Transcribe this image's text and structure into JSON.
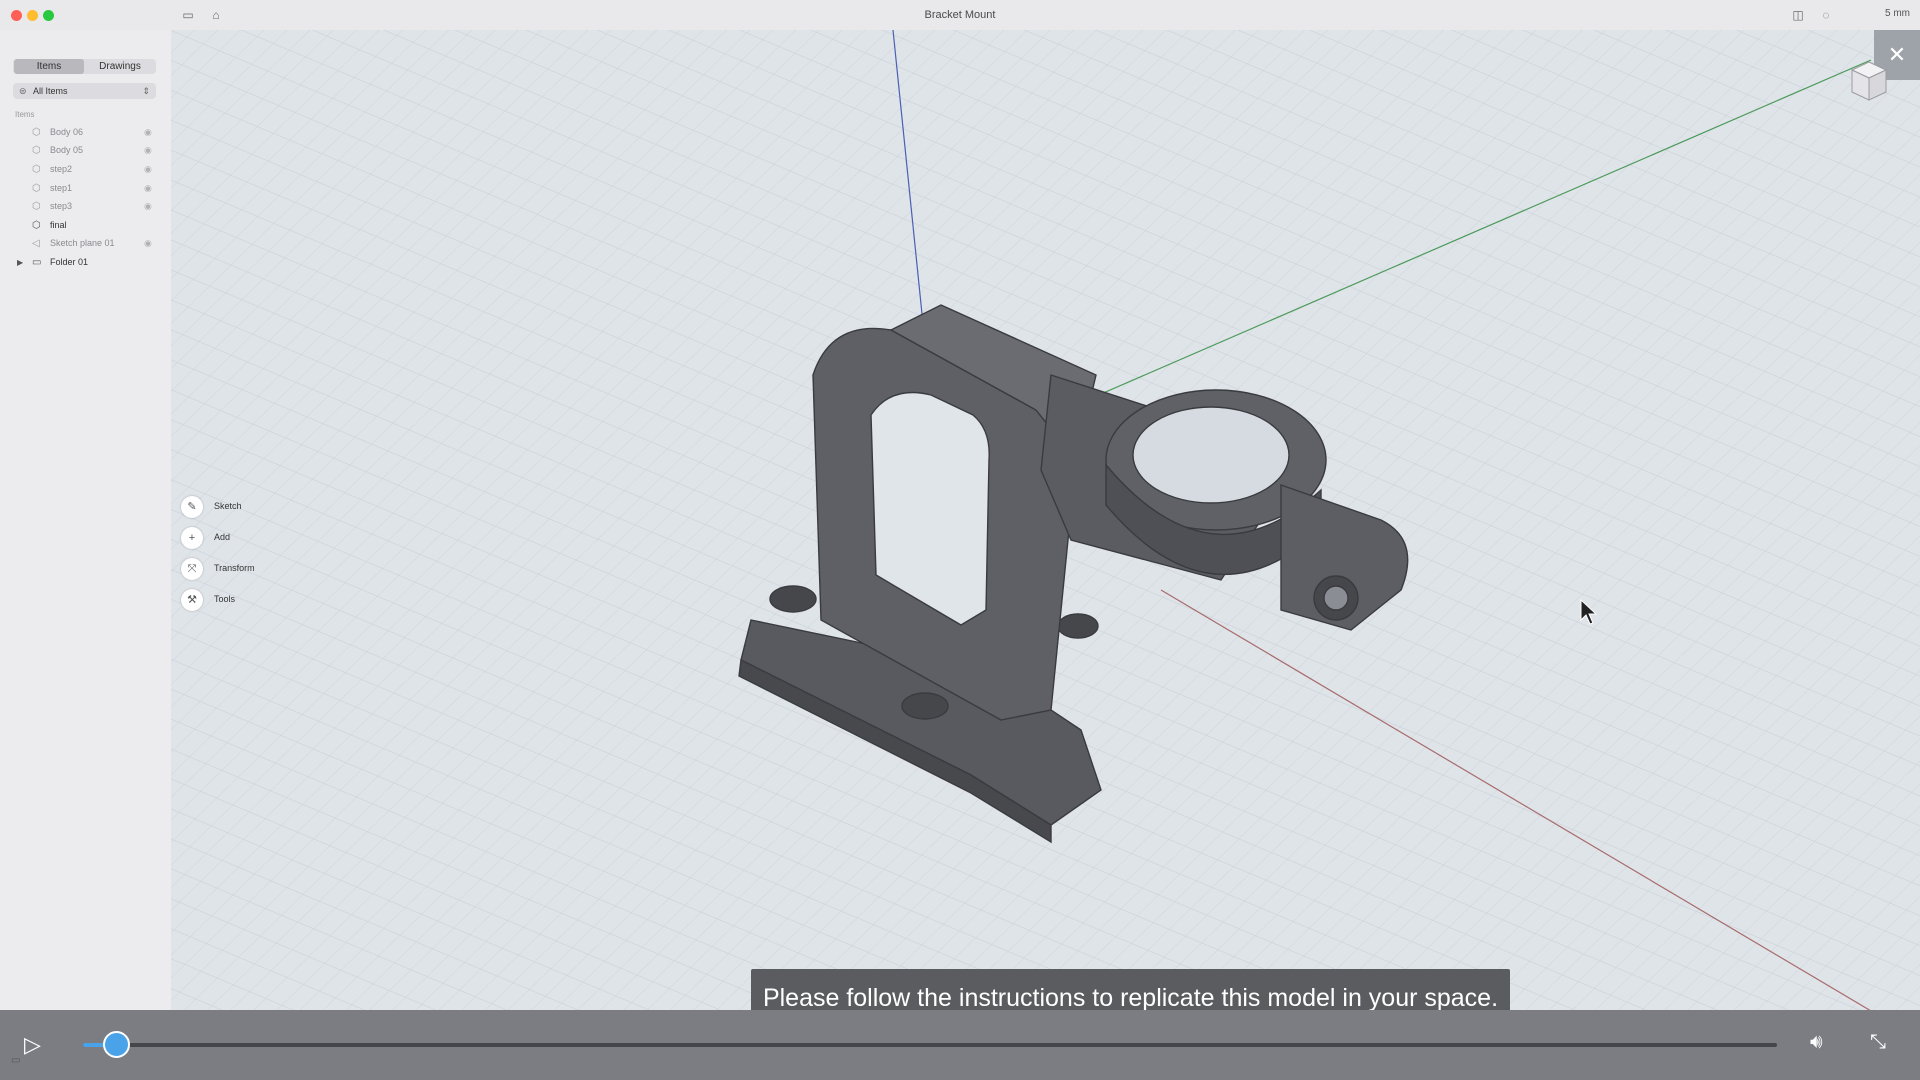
{
  "window": {
    "title": "Bracket Mount",
    "units": "5 mm"
  },
  "sidebar": {
    "tabs": [
      "Items",
      "Drawings"
    ],
    "filter": "All Items",
    "section": "Items",
    "items": [
      {
        "name": "Body 06"
      },
      {
        "name": "Body 05"
      },
      {
        "name": "step2"
      },
      {
        "name": "step1"
      },
      {
        "name": "step3"
      },
      {
        "name": "final"
      },
      {
        "name": "Sketch plane 01"
      },
      {
        "name": "Folder 01"
      }
    ]
  },
  "tools": [
    "Sketch",
    "Add",
    "Transform",
    "Tools"
  ],
  "caption": "Please follow the instructions to replicate this model in your space.",
  "video": {
    "progress": 0.02
  },
  "colors": {
    "accent": "#4aa3e8",
    "viewport": "#dfe4e9",
    "part": "#5d5e63",
    "grid_line": "#c9d0d8"
  },
  "icons": {
    "close": "close-icon",
    "play": "play-icon",
    "volume": "volume-icon",
    "shrink": "exit-fullscreen-icon",
    "view_cube": "view-cube-icon"
  }
}
